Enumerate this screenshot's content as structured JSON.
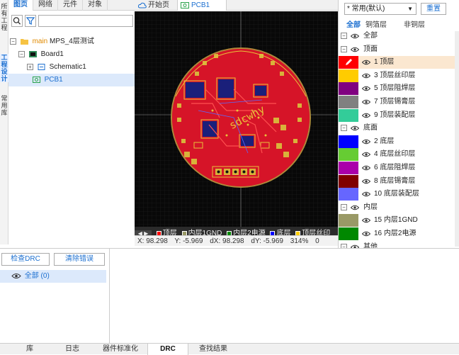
{
  "rail": {
    "tabs": [
      "所有工程",
      "工程设计",
      "常用库"
    ],
    "active": 1
  },
  "left_tabs": [
    {
      "label": "图页",
      "active": true
    },
    {
      "label": "网络",
      "active": false
    },
    {
      "label": "元件",
      "active": false
    },
    {
      "label": "对象",
      "active": false
    }
  ],
  "tree": {
    "project_tag": "main",
    "project_name": "MPS_4层测试",
    "board": "Board1",
    "schematic": "Schematic1",
    "pcb": "PCB1"
  },
  "doc_tabs": [
    {
      "label": "开始页",
      "icon": "cloud-icon"
    },
    {
      "label": "PCB1",
      "icon": "pcb-icon"
    }
  ],
  "canvas": {
    "silk_text": "sdcwhy"
  },
  "layer_strip": [
    {
      "label": "顶层",
      "color": "#ff0000"
    },
    {
      "label": "内层1GND",
      "color": "#999966"
    },
    {
      "label": "内层2电源",
      "color": "#008800"
    },
    {
      "label": "底层",
      "color": "#0000ff"
    },
    {
      "label": "顶层丝印",
      "color": "#ffcc00"
    }
  ],
  "coords": {
    "x": "X: 98.298",
    "y": "Y: -5.969",
    "dx": "dX: 98.298",
    "dy": "dY: -5.969",
    "zoom": "314%",
    "extra": "0"
  },
  "layers_panel": {
    "preset": "* 常用(默认)",
    "reset": "重置",
    "tabs": [
      "全部",
      "铜箔层",
      "非铜层"
    ],
    "active_tab": 0,
    "rows": [
      {
        "type": "group",
        "label": "全部"
      },
      {
        "type": "group",
        "label": "顶面"
      },
      {
        "type": "layer",
        "label": "1 顶层",
        "color": "#ff0000",
        "selected": true
      },
      {
        "type": "layer",
        "label": "3 顶层丝印层",
        "color": "#ffcc00"
      },
      {
        "type": "layer",
        "label": "5 顶层阻焊层",
        "color": "#800080"
      },
      {
        "type": "layer",
        "label": "7 顶层锡膏层",
        "color": "#808080"
      },
      {
        "type": "layer",
        "label": "9 顶层装配层",
        "color": "#33cc99"
      },
      {
        "type": "group",
        "label": "底面"
      },
      {
        "type": "layer",
        "label": "2 底层",
        "color": "#0000ff"
      },
      {
        "type": "layer",
        "label": "4 底层丝印层",
        "color": "#66cc33"
      },
      {
        "type": "layer",
        "label": "6 底层阻焊层",
        "color": "#aa00aa"
      },
      {
        "type": "layer",
        "label": "8 底层锡膏层",
        "color": "#800000"
      },
      {
        "type": "layer",
        "label": "10 底层装配层",
        "color": "#6666ff"
      },
      {
        "type": "group",
        "label": "内层"
      },
      {
        "type": "layer",
        "label": "15 内层1GND",
        "color": "#999966"
      },
      {
        "type": "layer",
        "label": "16 内层2电源",
        "color": "#008800"
      },
      {
        "type": "group",
        "label": "其他"
      }
    ]
  },
  "drc": {
    "check": "检查DRC",
    "clear": "清除错误",
    "all": "全部 (0)"
  },
  "bottom_tabs": [
    {
      "label": "库",
      "active": false
    },
    {
      "label": "日志",
      "active": false
    },
    {
      "label": "器件标准化",
      "active": false
    },
    {
      "label": "DRC",
      "active": true
    },
    {
      "label": "查找结果",
      "active": false
    }
  ]
}
